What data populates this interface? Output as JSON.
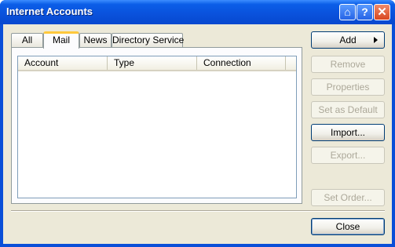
{
  "window": {
    "title": "Internet Accounts",
    "titlebar_buttons": [
      {
        "name": "pin-button",
        "icon": "pushpin-icon",
        "glyph": "⌂"
      },
      {
        "name": "help-button",
        "icon": "help-icon",
        "glyph": "?"
      },
      {
        "name": "close-button",
        "icon": "close-icon",
        "glyph": "✕"
      }
    ]
  },
  "tabs": [
    {
      "label": "All",
      "active": false
    },
    {
      "label": "Mail",
      "active": true
    },
    {
      "label": "News",
      "active": false
    },
    {
      "label": "Directory Service",
      "active": false
    }
  ],
  "list": {
    "columns": [
      "Account",
      "Type",
      "Connection"
    ],
    "rows": []
  },
  "buttons": {
    "add": {
      "label": "Add",
      "enabled": true
    },
    "remove": {
      "label": "Remove",
      "enabled": false
    },
    "properties": {
      "label": "Properties",
      "enabled": false
    },
    "set_default": {
      "label": "Set as Default",
      "enabled": false
    },
    "import": {
      "label": "Import...",
      "enabled": true
    },
    "export": {
      "label": "Export...",
      "enabled": false
    },
    "set_order": {
      "label": "Set Order...",
      "enabled": false
    },
    "close": {
      "label": "Close",
      "enabled": true
    }
  },
  "colors": {
    "titlebar": "#0a52dd",
    "face": "#ece9d8",
    "active_tab_accent": "#ffc83c"
  }
}
